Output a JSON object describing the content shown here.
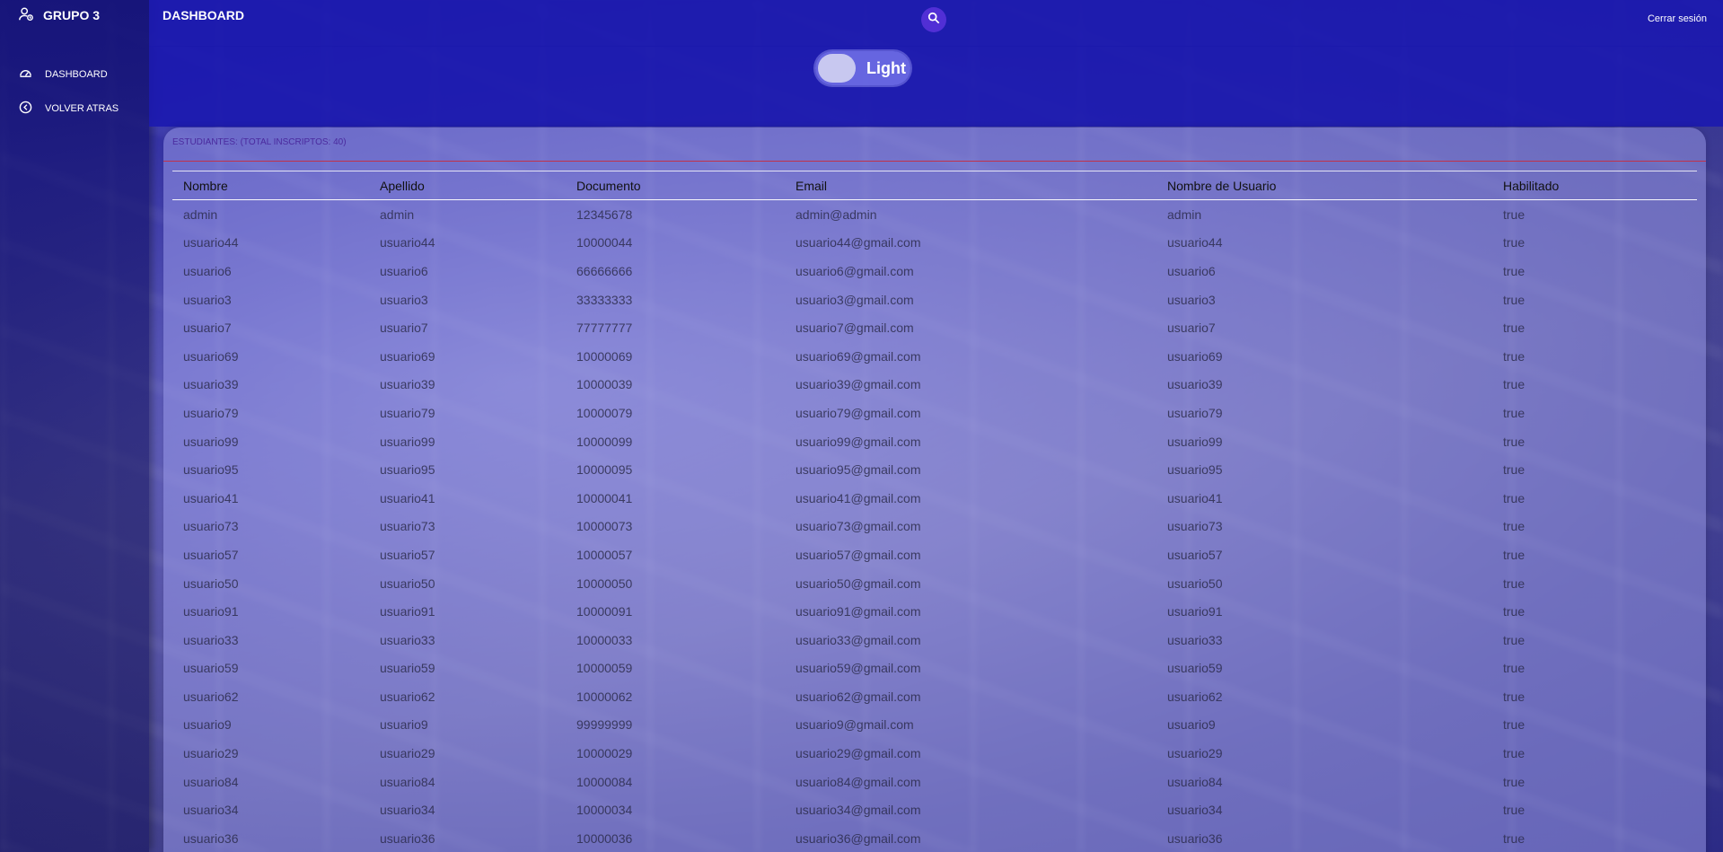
{
  "brand": {
    "name": "GRUPO 3"
  },
  "sidebar": {
    "items": [
      {
        "label": "DASHBOARD",
        "icon": "speedometer-icon"
      },
      {
        "label": "VOLVER ATRAS",
        "icon": "arrow-left-circle-icon"
      }
    ]
  },
  "topbar": {
    "title": "DASHBOARD",
    "logout_label": "Cerrar sesión"
  },
  "theme_toggle": {
    "label": "Light"
  },
  "card": {
    "title": "ESTUDIANTES: (TOTAL INSCRIPTOS: 40)"
  },
  "table": {
    "columns": [
      "Nombre",
      "Apellido",
      "Documento",
      "Email",
      "Nombre de Usuario",
      "Habilitado"
    ],
    "rows": [
      [
        "admin",
        "admin",
        "12345678",
        "admin@admin",
        "admin",
        "true"
      ],
      [
        "usuario44",
        "usuario44",
        "10000044",
        "usuario44@gmail.com",
        "usuario44",
        "true"
      ],
      [
        "usuario6",
        "usuario6",
        "66666666",
        "usuario6@gmail.com",
        "usuario6",
        "true"
      ],
      [
        "usuario3",
        "usuario3",
        "33333333",
        "usuario3@gmail.com",
        "usuario3",
        "true"
      ],
      [
        "usuario7",
        "usuario7",
        "77777777",
        "usuario7@gmail.com",
        "usuario7",
        "true"
      ],
      [
        "usuario69",
        "usuario69",
        "10000069",
        "usuario69@gmail.com",
        "usuario69",
        "true"
      ],
      [
        "usuario39",
        "usuario39",
        "10000039",
        "usuario39@gmail.com",
        "usuario39",
        "true"
      ],
      [
        "usuario79",
        "usuario79",
        "10000079",
        "usuario79@gmail.com",
        "usuario79",
        "true"
      ],
      [
        "usuario99",
        "usuario99",
        "10000099",
        "usuario99@gmail.com",
        "usuario99",
        "true"
      ],
      [
        "usuario95",
        "usuario95",
        "10000095",
        "usuario95@gmail.com",
        "usuario95",
        "true"
      ],
      [
        "usuario41",
        "usuario41",
        "10000041",
        "usuario41@gmail.com",
        "usuario41",
        "true"
      ],
      [
        "usuario73",
        "usuario73",
        "10000073",
        "usuario73@gmail.com",
        "usuario73",
        "true"
      ],
      [
        "usuario57",
        "usuario57",
        "10000057",
        "usuario57@gmail.com",
        "usuario57",
        "true"
      ],
      [
        "usuario50",
        "usuario50",
        "10000050",
        "usuario50@gmail.com",
        "usuario50",
        "true"
      ],
      [
        "usuario91",
        "usuario91",
        "10000091",
        "usuario91@gmail.com",
        "usuario91",
        "true"
      ],
      [
        "usuario33",
        "usuario33",
        "10000033",
        "usuario33@gmail.com",
        "usuario33",
        "true"
      ],
      [
        "usuario59",
        "usuario59",
        "10000059",
        "usuario59@gmail.com",
        "usuario59",
        "true"
      ],
      [
        "usuario62",
        "usuario62",
        "10000062",
        "usuario62@gmail.com",
        "usuario62",
        "true"
      ],
      [
        "usuario9",
        "usuario9",
        "99999999",
        "usuario9@gmail.com",
        "usuario9",
        "true"
      ],
      [
        "usuario29",
        "usuario29",
        "10000029",
        "usuario29@gmail.com",
        "usuario29",
        "true"
      ],
      [
        "usuario84",
        "usuario84",
        "10000084",
        "usuario84@gmail.com",
        "usuario84",
        "true"
      ],
      [
        "usuario34",
        "usuario34",
        "10000034",
        "usuario34@gmail.com",
        "usuario34",
        "true"
      ],
      [
        "usuario36",
        "usuario36",
        "10000036",
        "usuario36@gmail.com",
        "usuario36",
        "true"
      ]
    ]
  },
  "colors": {
    "topbar": "#1c1aaf",
    "search_button": "#5a32dc",
    "card_header_text": "#4a2a9e",
    "card_header_rule": "#c0324a"
  }
}
